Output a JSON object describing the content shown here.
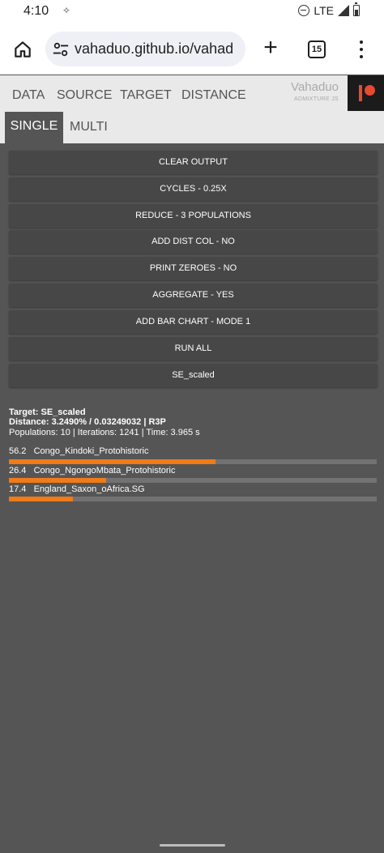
{
  "status_bar": {
    "time": "4:10",
    "network": "LTE",
    "icons": [
      "notification-star-icon",
      "do-not-disturb-icon",
      "signal-icon",
      "battery-icon"
    ]
  },
  "browser": {
    "url": "vahaduo.github.io/vahad",
    "tab_count": "15",
    "icons": [
      "home-icon",
      "site-settings-icon",
      "new-tab-icon",
      "tabs-icon",
      "more-menu-icon"
    ]
  },
  "nav": {
    "tabs": [
      "DATA",
      "SOURCE",
      "TARGET",
      "DISTANCE"
    ],
    "brand_name": "Vahaduo",
    "brand_sub": "ADMIXTURE JS",
    "subtabs": [
      "SINGLE",
      "MULTI"
    ],
    "active_subtab": "SINGLE"
  },
  "buttons": [
    "CLEAR OUTPUT",
    "CYCLES - 0.25X",
    "REDUCE - 3 POPULATIONS",
    "ADD DIST COL - NO",
    "PRINT ZEROES - NO",
    "AGGREGATE - YES",
    "ADD BAR CHART - MODE 1",
    "RUN ALL",
    "SE_scaled"
  ],
  "output": {
    "target_line": "Target: SE_scaled",
    "distance_line": "Distance: 3.2490% / 0.03249032 | R3P",
    "stats_line": "Populations: 10 | Iterations: 1241 | Time: 3.965 s",
    "results": [
      {
        "value": "56.2",
        "name": "Congo_Kindoki_Protohistoric",
        "pct": 56.2
      },
      {
        "value": "26.4",
        "name": "Congo_NgongoMbata_Protohistoric",
        "pct": 26.4
      },
      {
        "value": "17.4",
        "name": "England_Saxon_oAfrica.SG",
        "pct": 17.4
      }
    ]
  },
  "colors": {
    "background": "#555555",
    "button": "#474747",
    "bar_fill": "#f07b17",
    "bar_track": "#727272",
    "nav_bg": "#e9e9e9",
    "patreon": "#e84a2f"
  }
}
